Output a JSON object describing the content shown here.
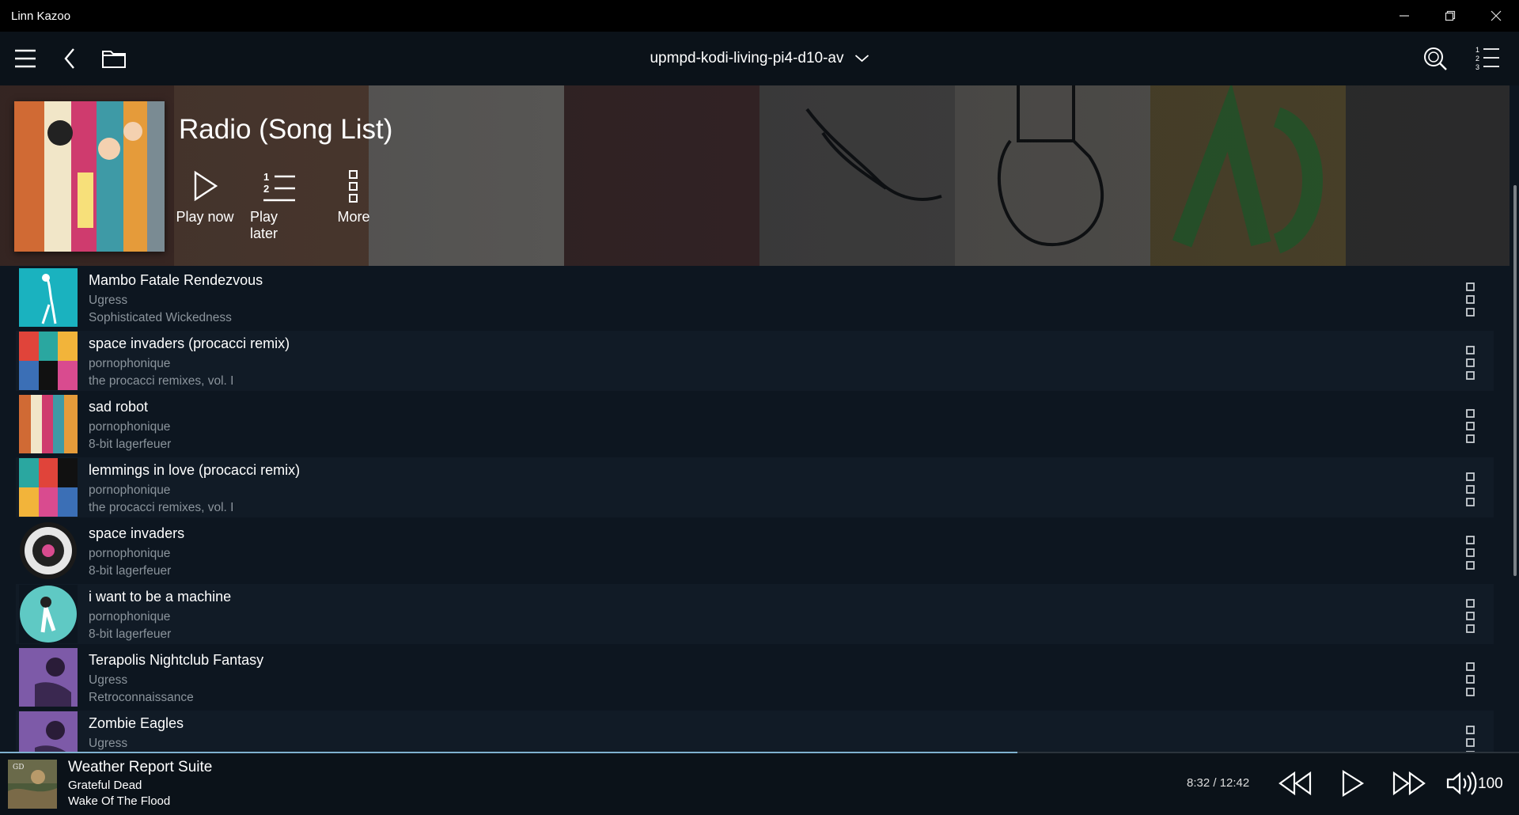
{
  "app": {
    "title": "Linn Kazoo"
  },
  "toolbar": {
    "room": "upmpd-kodi-living-pi4-d10-av"
  },
  "hero": {
    "title": "Radio (Song List)",
    "actions": {
      "play_now": "Play now",
      "play_later": "Play later",
      "more": "More"
    }
  },
  "tracks": [
    {
      "title": "Mambo Fatale Rendezvous",
      "artist": "Ugress",
      "album": "Sophisticated Wickedness"
    },
    {
      "title": "space invaders (procacci remix)",
      "artist": "pornophonique",
      "album": "the procacci remixes, vol. I"
    },
    {
      "title": "sad robot",
      "artist": "pornophonique",
      "album": "8-bit lagerfeuer"
    },
    {
      "title": "lemmings in love (procacci remix)",
      "artist": "pornophonique",
      "album": "the procacci remixes, vol. I"
    },
    {
      "title": "space invaders",
      "artist": "pornophonique",
      "album": "8-bit lagerfeuer"
    },
    {
      "title": "i want to be a machine",
      "artist": "pornophonique",
      "album": "8-bit lagerfeuer"
    },
    {
      "title": "Terapolis Nightclub Fantasy",
      "artist": "Ugress",
      "album": "Retroconnaissance"
    },
    {
      "title": "Zombie Eagles",
      "artist": "Ugress",
      "album": ""
    }
  ],
  "now_playing": {
    "title": "Weather Report Suite",
    "artist": "Grateful Dead",
    "album": "Wake Of The Flood",
    "time": "8:32 / 12:42",
    "progress": 0.67,
    "volume": "100"
  }
}
